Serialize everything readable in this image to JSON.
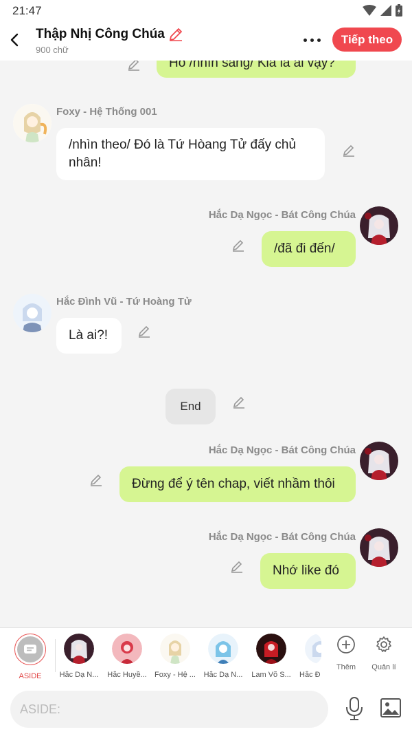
{
  "status": {
    "time": "21:47"
  },
  "header": {
    "title": "Thập Nhị Công Chúa",
    "subtitle": "900 chữ",
    "next_label": "Tiếp theo"
  },
  "messages": [
    {
      "id": "m0",
      "text": "Hồ /nhìn sang/ Kia là ai vậy?"
    },
    {
      "id": "m1",
      "sender": "Foxy - Hệ Thống 001",
      "text_line1": "/nhìn theo/ Đó là Tứ Hòang Tử đấy chủ",
      "text_line2": "nhân!"
    },
    {
      "id": "m2",
      "sender": "Hắc Dạ Ngọc - Bát Công Chúa",
      "text": "/đã đi đến/"
    },
    {
      "id": "m3",
      "sender": "Hắc Đình Vũ - Tứ Hoàng Tử",
      "text": "Là ai?!"
    },
    {
      "id": "m4",
      "text": "End"
    },
    {
      "id": "m5",
      "sender": "Hắc Dạ Ngọc - Bát Công Chúa",
      "text": "Đừng để ý tên chap, viết nhầm thôi"
    },
    {
      "id": "m6",
      "sender": "Hắc Dạ Ngọc - Bát Công Chúa",
      "text": "Nhớ like đó"
    }
  ],
  "characters": [
    {
      "label": "ASIDE"
    },
    {
      "label": "Hắc Dạ N..."
    },
    {
      "label": "Hắc Huyề..."
    },
    {
      "label": "Foxy - Hệ ..."
    },
    {
      "label": "Hắc Dạ N..."
    },
    {
      "label": "Lam Võ S..."
    },
    {
      "label": "Hắc Đ"
    }
  ],
  "tools": {
    "add_label": "Thêm",
    "manage_label": "Quản lí"
  },
  "composer": {
    "placeholder": "ASIDE:"
  }
}
